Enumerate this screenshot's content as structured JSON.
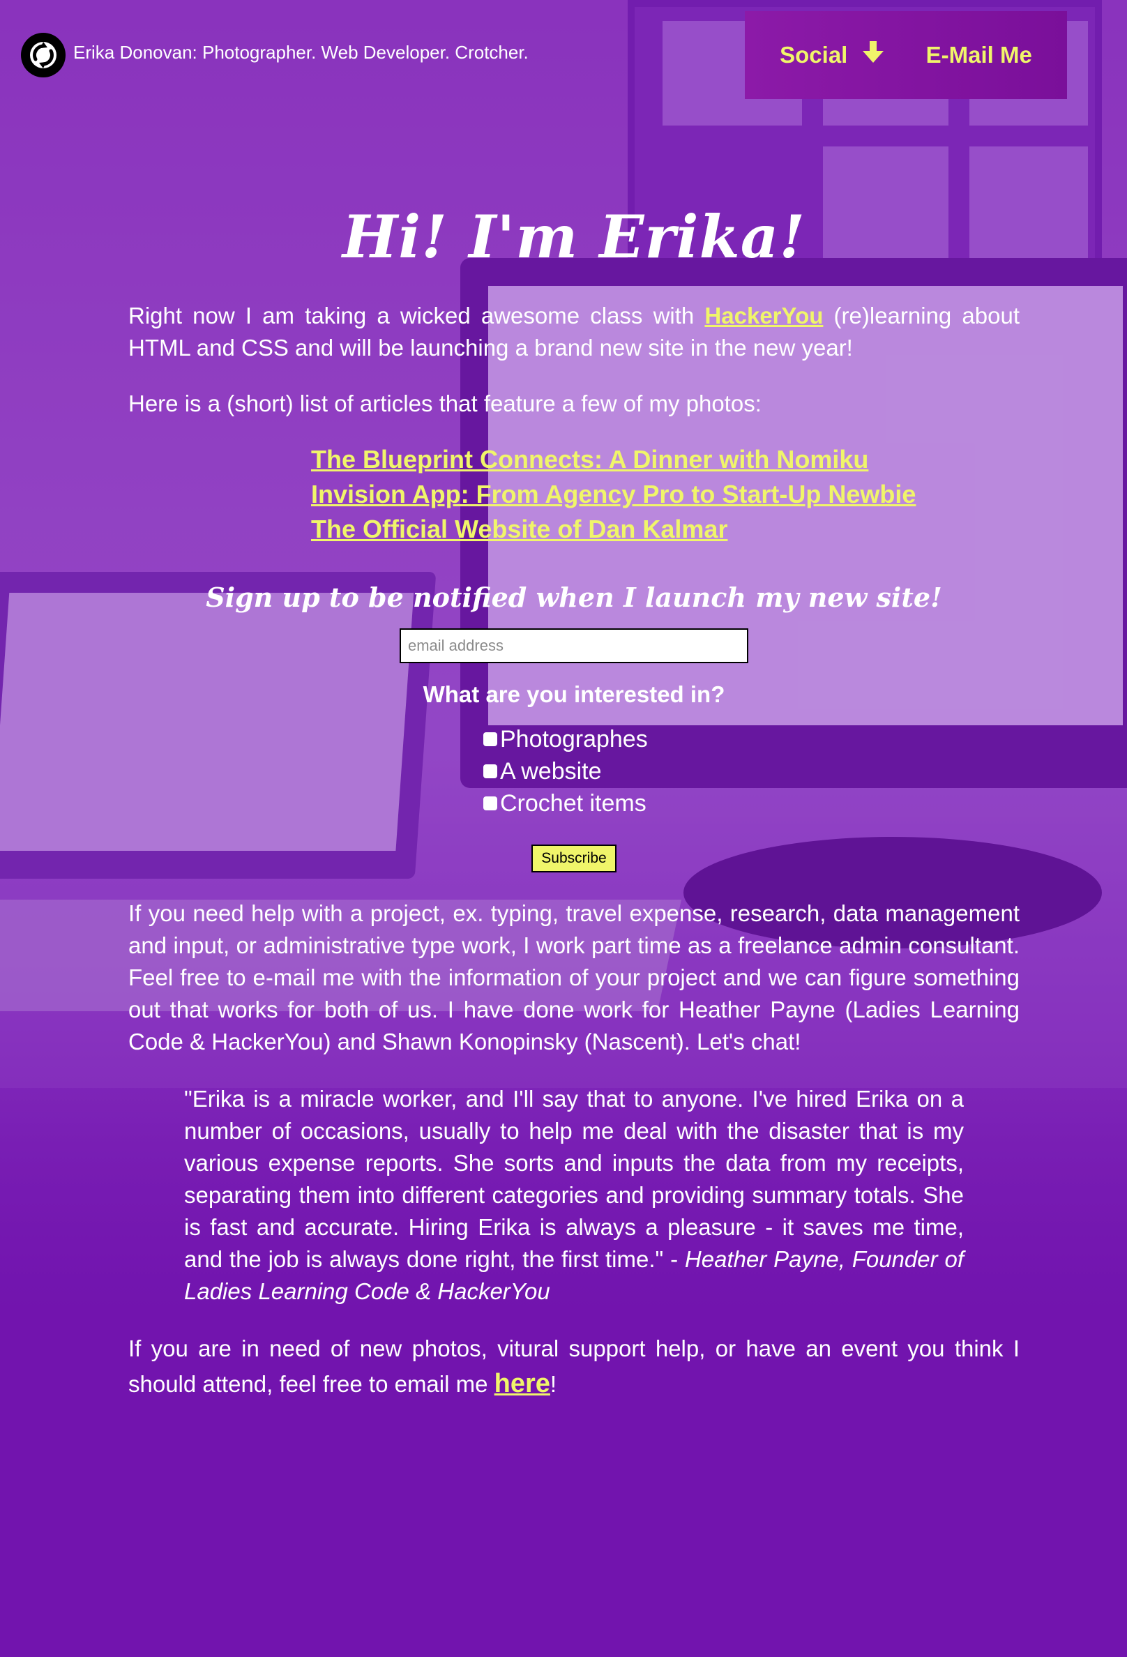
{
  "header": {
    "site_title": "Erika Donovan: Photographer. Web Developer. Crotcher.",
    "nav": {
      "social_label": "Social",
      "email_label": "E-Mail Me"
    }
  },
  "intro": {
    "heading": "Hi! I'm Erika!",
    "para1_before": "Right now I am taking a wicked awesome class with",
    "para1_link": "HackerYou",
    "para1_after": "(re)learning about HTML and CSS and will be launching a brand new site in the new year!",
    "articles_lead": "Here is a (short) list of articles that feature a few of my photos:",
    "articles": [
      "The Blueprint Connects: A Dinner with Nomiku",
      "Invision App: From Agency Pro to Start-Up Newbie",
      "The Official Website of Dan Kalmar"
    ]
  },
  "signup": {
    "title": "Sign up to be notified when I launch my new site!",
    "email_placeholder": "email address",
    "question": "What are you interested in?",
    "options": [
      "Photographes",
      "A website",
      "Crochet items"
    ],
    "subscribe_label": "Subscribe"
  },
  "freelance": {
    "text": "If you need help with a project, ex. typing, travel expense, research, data management and input, or administrative type work, I work part time as a freelance admin consultant. Feel free to e-mail me with the information of your project and we can figure something out that works for both of us. I have done work for Heather Payne (Ladies Learning Code & HackerYou) and Shawn Konopinsky (Nascent). Let's chat!"
  },
  "testimonial": {
    "quote": "\"Erika is a miracle worker, and I'll say that to anyone. I've hired Erika on a number of occasions, usually to help me deal with the disaster that is my various expense reports. She sorts and inputs the data from my receipts, separating them into different categories and providing summary totals. She is fast and accurate. Hiring Erika is always a pleasure - it saves me time, and the job is always done right, the first time.\" -",
    "attribution": "Heather Payne, Founder of Ladies Learning Code & HackerYou"
  },
  "closing": {
    "before": "If you are in need of new photos, vitural support help, or have an event you think I should attend, feel free to email me",
    "link": "here",
    "after": "!"
  },
  "colors": {
    "accent": "#f0f56a",
    "nav_bg": "#8c1aa8",
    "background": "#6a12a8"
  },
  "icons": {
    "logo": "refresh-logo-icon",
    "social_arrow": "arrow-down-icon"
  }
}
